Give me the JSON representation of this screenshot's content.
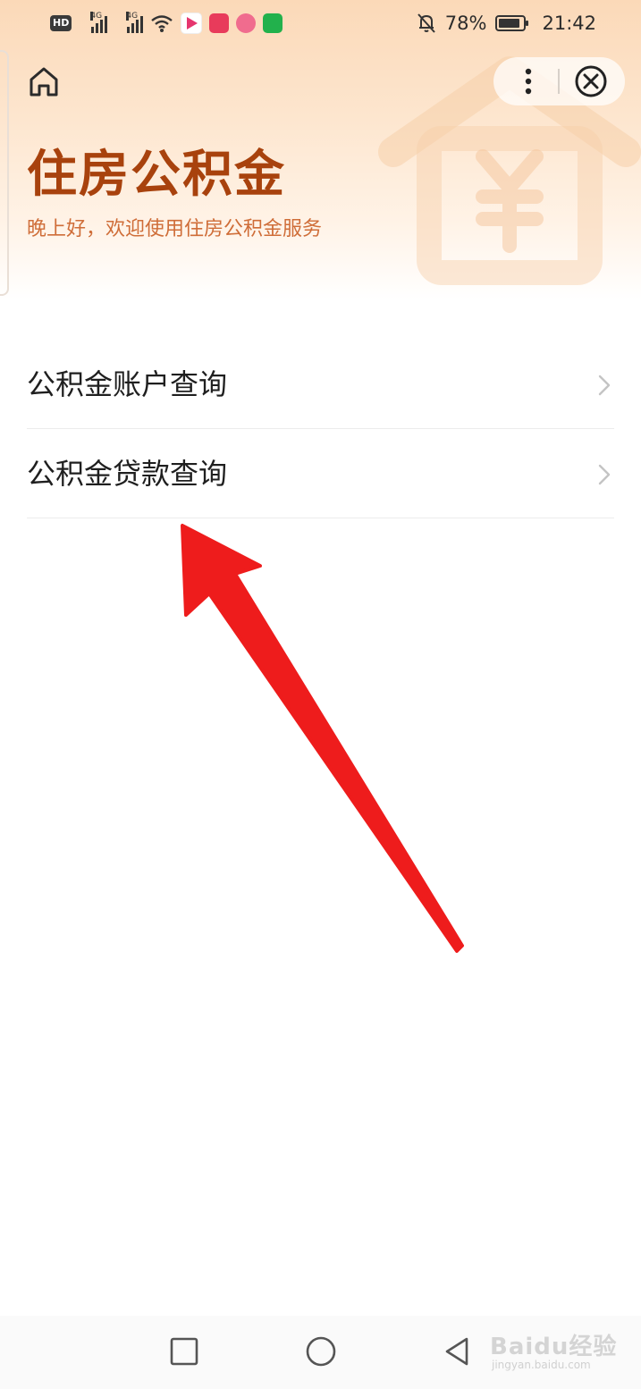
{
  "status_bar": {
    "hd_badge": "HD",
    "network_1": "4G",
    "network_2": "4G",
    "battery_percent": "78%",
    "time": "21:42"
  },
  "nav": {
    "home_icon": "home-icon",
    "more_icon": "more-vertical-icon",
    "close_icon": "close-circle-icon"
  },
  "header": {
    "title": "住房公积金",
    "subtitle": "晚上好，欢迎使用住房公积金服务"
  },
  "menu": {
    "items": [
      {
        "label": "公积金账户查询"
      },
      {
        "label": "公积金贷款查询"
      }
    ]
  },
  "system_nav": {
    "recents_icon": "square-icon",
    "home_icon": "circle-icon",
    "back_icon": "triangle-back-icon"
  },
  "watermark": {
    "brand": "Baidu经验",
    "url": "jingyan.baidu.com"
  },
  "colors": {
    "title": "#a8420d",
    "subtitle": "#cf6d38",
    "hero_top": "#fbd9b8",
    "arrow": "#ee1c1c"
  }
}
